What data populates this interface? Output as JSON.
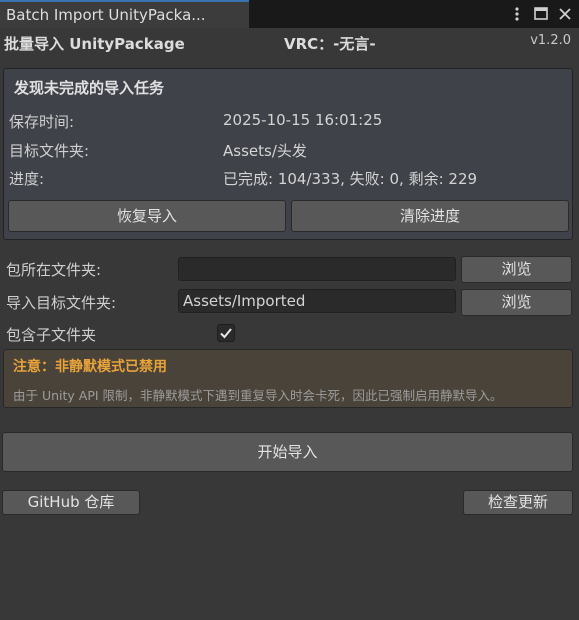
{
  "window": {
    "tab_title": "Batch Import UnityPacka..."
  },
  "header": {
    "app_title": "批量导入 UnityPackage",
    "vrc_title": "VRC：-无言-",
    "version": "v1.2.0"
  },
  "task": {
    "title": "发现未完成的导入任务",
    "save_time_label": "保存时间:",
    "save_time_value": "2025-10-15 16:01:25",
    "target_folder_label": "目标文件夹:",
    "target_folder_value": "Assets/头发",
    "progress_label": "进度:",
    "progress_value": "已完成: 104/333, 失败: 0, 剩余: 229",
    "resume_label": "恢复导入",
    "clear_label": "清除进度"
  },
  "form": {
    "package_folder_label": "包所在文件夹:",
    "package_folder_value": "",
    "target_folder_label": "导入目标文件夹:",
    "target_folder_value": "Assets/Imported",
    "browse_label": "浏览",
    "include_subfolders_label": "包含子文件夹",
    "include_subfolders_checked": true
  },
  "warning": {
    "title": "注意：非静默模式已禁用",
    "text": "由于 Unity API 限制，非静默模式下遇到重复导入时会卡死，因此已强制启用静默导入。"
  },
  "actions": {
    "start_label": "开始导入",
    "github_label": "GitHub 仓库",
    "check_update_label": "检查更新"
  },
  "colors": {
    "background": "#383838",
    "task_panel": "#3f4249",
    "warning_panel": "#4a4339",
    "warning_accent": "#e8a33a",
    "button": "#585858",
    "tab_accent": "#3a72b0"
  }
}
